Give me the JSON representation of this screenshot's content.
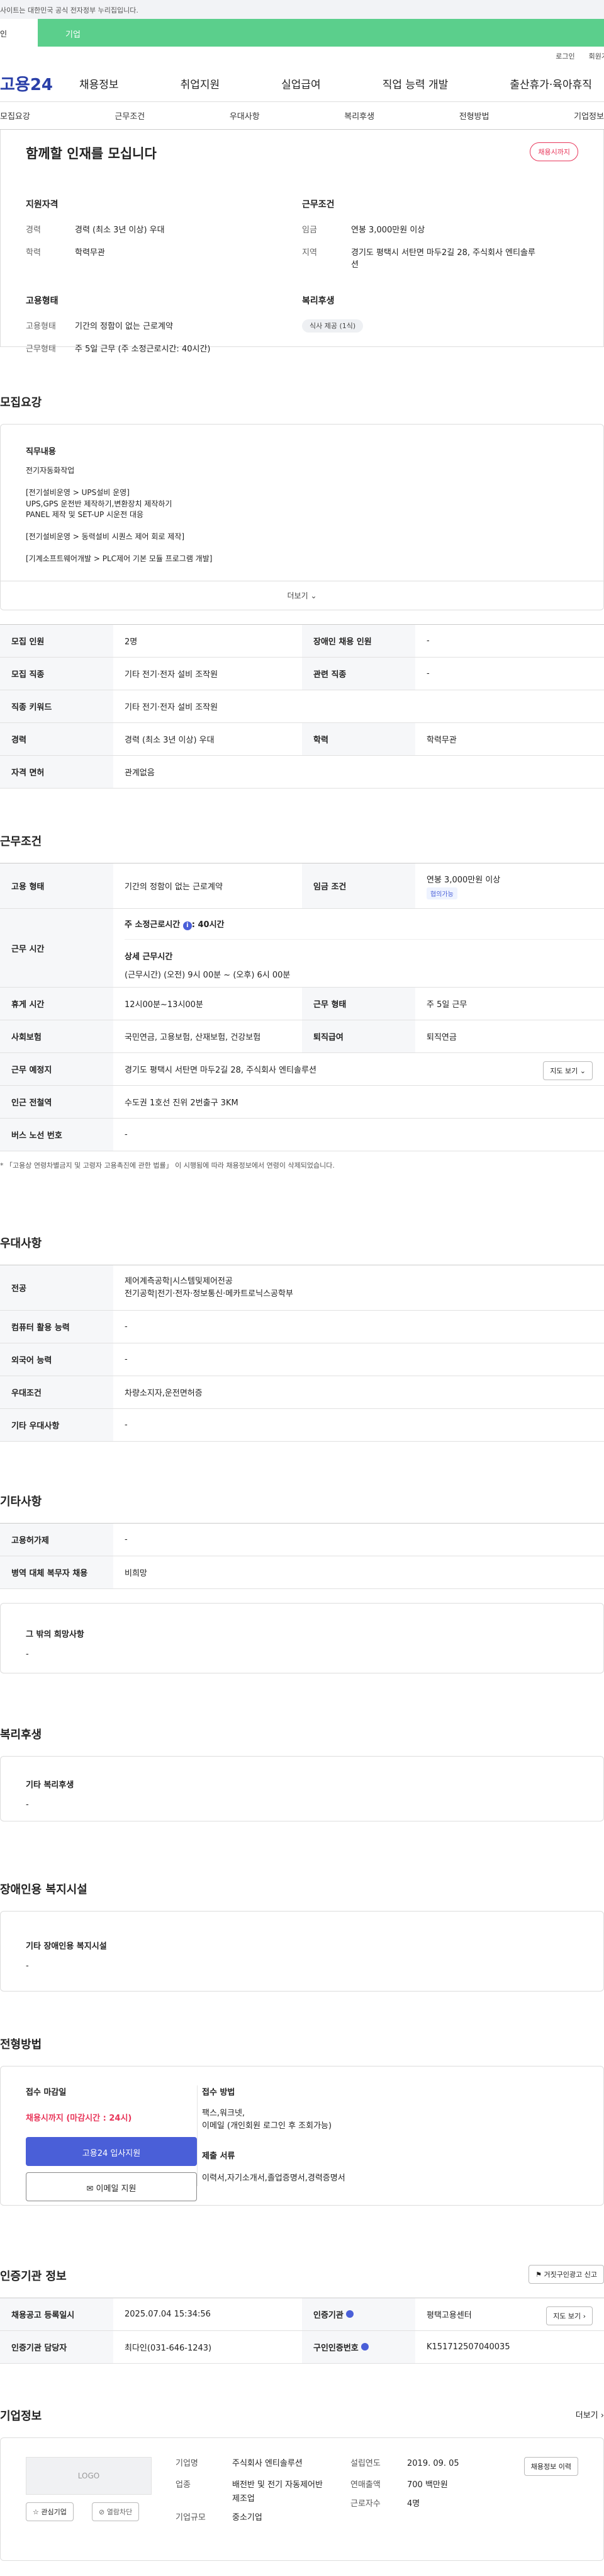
{
  "gov_bar": "사이트는 대한민국 공식 전자정부 누리집입니다.",
  "tabs": {
    "individual": "인",
    "corporate": "기업"
  },
  "util": {
    "login": "로그인",
    "signup": "회원가"
  },
  "logo": "고용24",
  "gnb": [
    "채용정보",
    "취업지원",
    "실업급여",
    "직업 능력 개발",
    "출산휴가·육아휴직"
  ],
  "subnav": [
    "모집요강",
    "근무조건",
    "우대사항",
    "복리후생",
    "전형방법",
    "기업정보"
  ],
  "summary": {
    "title": "함께할 인재를 모십니다",
    "badge": "채용시까지",
    "qual_head": "지원자격",
    "qual": [
      {
        "k": "경력",
        "v": "경력 (최소 3년 이상) 우대"
      },
      {
        "k": "학력",
        "v": "학력무관"
      }
    ],
    "cond_head": "근무조건",
    "cond": [
      {
        "k": "임금",
        "v": "연봉 3,000만원 이상"
      },
      {
        "k": "지역",
        "v": "경기도 평택시 서탄면 마두2길 28, 주식회사 엔티솔루션"
      }
    ],
    "emp_head": "고용형태",
    "emp": [
      {
        "k": "고용형태",
        "v": "기간의 정함이 없는 근로계약"
      },
      {
        "k": "근무형태",
        "v": "주 5일 근무 (주 소정근로시간: 40시간)"
      }
    ],
    "welfare_head": "복리후생",
    "welfare_chip": "식사 제공 (1식)"
  },
  "recruit": {
    "title": "모집요강",
    "duty_head": "직무내용",
    "duty_lines": [
      "전기자동화작업",
      "",
      "[전기설비운영 > UPS설비 운영]",
      "UPS,GPS 운전반 제작하기,변환장치 제작하기",
      "PANEL 제작 및 SET-UP 시운전 대응",
      "",
      "[전기설비운영 > 동력설비 시퀀스 제어 회로 제작]",
      "",
      "[기계소프트웨어개발 > PLC제어 기본 모듈 프로그램 개발]"
    ],
    "more": "더보기",
    "rows": [
      {
        "k": "모집 인원",
        "v": "2명",
        "k2": "장애인 채용 인원",
        "v2": "-"
      },
      {
        "k": "모집 직종",
        "v": "기타 전기·전자 설비 조작원",
        "k2": "관련 직종",
        "v2": "-"
      },
      {
        "k": "직종 키워드",
        "v": "기타 전기·전자 설비 조작원"
      },
      {
        "k": "경력",
        "v": "경력 (최소 3년 이상) 우대",
        "k2": "학력",
        "v2": "학력무관"
      },
      {
        "k": "자격 면허",
        "v": "관계없음"
      }
    ]
  },
  "work": {
    "title": "근무조건",
    "emp_k": "고용 형태",
    "emp_v": "기간의 정함이 없는 근로계약",
    "wage_k": "임금 조건",
    "wage_v": "연봉 3,000만원 이상",
    "wage_tag": "협의가능",
    "time_k": "근무 시간",
    "time_main": "주 소정근로시간",
    "time_info": "i",
    "time_main_v": ": 40시간",
    "time_detail_head": "상세 근무시간",
    "time_detail": "(근무시간) (오전) 9시 00분 ~ (오후) 6시 00분",
    "rest_k": "휴게 시간",
    "rest_v": "12시00분~13시00분",
    "wtype_k": "근무 형태",
    "wtype_v": "주 5일 근무",
    "ins_k": "사회보험",
    "ins_v": "국민연금, 고용보험, 산재보험, 건강보험",
    "ret_k": "퇴직급여",
    "ret_v": "퇴직연금",
    "place_k": "근무 예정지",
    "place_v": "경기도 평택시 서탄면 마두2길 28, 주식회사 엔티솔루션",
    "map_btn": "지도 보기",
    "sub_k": "인근 전철역",
    "sub_v": "수도권 1호선 진위 2번출구 3KM",
    "bus_k": "버스 노선 번호",
    "bus_v": "-",
    "note": "「고용상 연령차별금지 및 고령자 고용촉진에 관한 법률」 이 시행됨에 따라 채용정보에서 연령이 삭제되었습니다."
  },
  "pref": {
    "title": "우대사항",
    "rows": [
      {
        "k": "전공",
        "v": "제어계측공학|시스템및제어전공",
        "v_b": "전기공학|전기·전자·정보통신·메카트로닉스공학부"
      },
      {
        "k": "컴퓨터 활용 능력",
        "v": "-"
      },
      {
        "k": "외국어 능력",
        "v": "-"
      },
      {
        "k": "우대조건",
        "v": "차량소지자,운전면허증"
      },
      {
        "k": "기타 우대사항",
        "v": "-"
      }
    ]
  },
  "etc": {
    "title": "기타사항",
    "rows": [
      {
        "k": "고용허가제",
        "v": "-"
      },
      {
        "k": "병역 대체 복무자 채용",
        "v": "비희망"
      }
    ],
    "other_head": "그 밖의 희망사항",
    "other_v": "-"
  },
  "welfare": {
    "title": "복리후생",
    "head": "기타 복리후생",
    "v": "-"
  },
  "disabled": {
    "title": "장애인용 복지시설",
    "head": "기타 장애인용 복지시설",
    "v": "-"
  },
  "selection": {
    "title": "전형방법",
    "deadline_head": "접수 마감일",
    "deadline_v": "채용시까지 (마감시간 : 24시)",
    "apply_btn": "고용24 입사지원",
    "email_btn": "이메일 지원",
    "method_head": "접수 방법",
    "method_v": "팩스,워크넷,",
    "method_v2": "이메일 (개인회원 로그인 후 조회가능)",
    "docs_head": "제출 서류",
    "docs_v": "이력서,자기소개서,졸업증명서,경력증명서"
  },
  "cert": {
    "title": "인증기관 정보",
    "report_btn": "거짓구인광고 신고",
    "reg_k": "채용공고 등록일시",
    "reg_v": "2025.07.04 15:34:56",
    "org_k": "인증기관",
    "org_v": "평택고용센터",
    "map_btn": "지도 보기",
    "mgr_k": "인증기관 담당자",
    "mgr_v": "최다인(031-646-1243)",
    "no_k": "구인인증번호",
    "no_v": "K151712507040035"
  },
  "company": {
    "title": "기업정보",
    "more": "더보기",
    "logo": "LOGO",
    "fav": "관심기업",
    "block": "열람차단",
    "name_k": "기업명",
    "name_v": "주식회사 엔티솔루션",
    "ind_k": "업종",
    "ind_v": "배전반 및 전기 자동제어반 제조업",
    "size_k": "기업규모",
    "size_v": "중소기업",
    "est_k": "설립연도",
    "est_v": "2019. 09. 05",
    "sales_k": "연매출액",
    "sales_v": "700 백만원",
    "emp_k": "근로자수",
    "emp_v": "4명",
    "history_btn": "채용정보 이력"
  },
  "colors": {
    "accent": "#4a5fd8",
    "green": "#5bcf8c",
    "red": "#e8365a",
    "logo": "#2a3fa8"
  }
}
